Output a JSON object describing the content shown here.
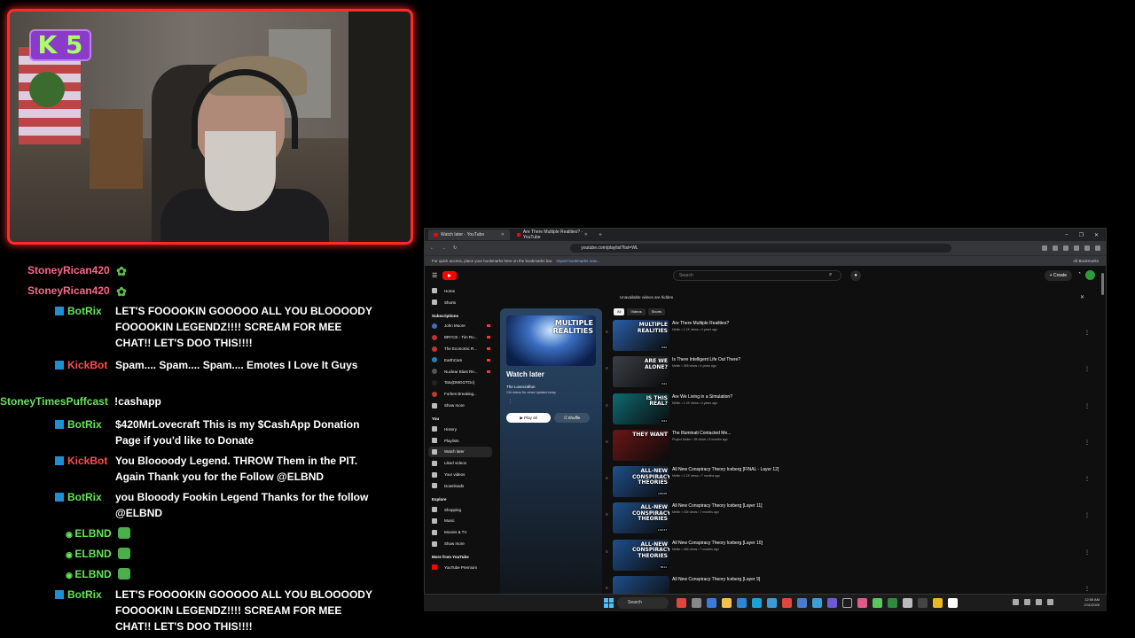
{
  "webcam": {
    "badge_text": "K 5"
  },
  "chat": {
    "messages": [
      {
        "user": "StoneyRican420",
        "text": "",
        "color": "pink"
      },
      {
        "user": "StoneyRican420",
        "text": "",
        "color": "pink"
      },
      {
        "user": "BotRix",
        "text": "LET'S FOOOOKIN GOOOOO ALL YOU BLOOOODY FOOOOKIN LEGENDZ!!!! SCREAM FOR MEE CHAT!! LET'S DOO THIS!!!!",
        "color": "green"
      },
      {
        "user": "KickBot",
        "text": "Spam.... Spam.... Spam.... Emotes I Love It Guys",
        "color": "red"
      },
      {
        "user": "StoneyTimesPuffcast",
        "text": "!cashapp",
        "color": "green"
      },
      {
        "user": "BotRix",
        "text": "$420MrLovecraft This is my $CashApp Donation Page if you'd like to Donate",
        "color": "green"
      },
      {
        "user": "KickBot",
        "text": "You Bloooody Legend. THROW Them in the PIT. Again Thank you for the Follow @ELBND",
        "color": "red"
      },
      {
        "user": "BotRix",
        "text": "you Blooody Fookin Legend Thanks for the follow @ELBND",
        "color": "green"
      },
      {
        "user": "ELBND",
        "text": "",
        "color": "green"
      },
      {
        "user": "ELBND",
        "text": "",
        "color": "green"
      },
      {
        "user": "ELBND",
        "text": "",
        "color": "green"
      },
      {
        "user": "BotRix",
        "text": "LET'S FOOOOKIN GOOOOO ALL YOU BLOOOODY FOOOOKIN LEGENDZ!!!! SCREAM FOR MEE CHAT!! LET'S DOO THIS!!!!",
        "color": "green"
      }
    ]
  },
  "browser": {
    "tabs": [
      {
        "title": "Watch later - YouTube",
        "active": true
      },
      {
        "title": "Are There Multiple Realities? - YouTube",
        "active": false
      }
    ],
    "new_tab": "+",
    "url": "youtube.com/playlist?list=WL",
    "bookmarks_notice": "For quick access, place your bookmarks here on the bookmarks bar.",
    "bookmarks_link": "Import bookmarks now...",
    "all_bookmarks": "All Bookmarks"
  },
  "youtube": {
    "search_placeholder": "Search",
    "create_label": "+ Create",
    "sidebar": {
      "top": [
        "Home",
        "Shorts"
      ],
      "subscriptions_title": "Subscriptions",
      "subscriptions": [
        "John Moore",
        "BRYCE - Tim Ro...",
        "The Economic R...",
        "EarthCam",
        "Nuclear Blast Re...",
        "Tatu(DMGGTOo)",
        "Forbes Breaking..."
      ],
      "show_more": "Show more",
      "you_title": "You",
      "you": [
        "History",
        "Playlists",
        "Watch later",
        "Liked videos",
        "Your videos",
        "Downloads"
      ],
      "explore_title": "Explore",
      "explore": [
        "Shopping",
        "Music",
        "Movies & TV",
        "Show more"
      ],
      "more_title": "More from YouTube",
      "more": [
        "YouTube Premium"
      ]
    },
    "playlist": {
      "thumb_text": "MULTIPLE REALITIES",
      "title": "Watch later",
      "owner": "The Lovecrafton",
      "meta": "134 videos  No views  Updated today",
      "play_all": "▶ Play all",
      "shuffle": "⤮ Shuffle"
    },
    "notice": "Unavailable videos are hidden",
    "chips": [
      "All",
      "Videos",
      "Shorts"
    ],
    "videos": [
      {
        "title": "Are There Multiple Realities?",
        "meta": "Meller • 1.1K views • 4 years ago",
        "thumb_text": "MULTIPLE REALITIES",
        "duration": "8:52",
        "color": "#2a5ea8"
      },
      {
        "title": "Is There Intelligent Life Out There?",
        "meta": "Meller • 395 views • 4 years ago",
        "thumb_text": "ARE WE ALONE?",
        "duration": "9:21",
        "color": "#3b3f46"
      },
      {
        "title": "Are We Living in a Simulation?",
        "meta": "Meller • 1.2K views • 4 years ago",
        "thumb_text": "IS THIS REAL?",
        "duration": "8:41",
        "color": "#0e6a73"
      },
      {
        "title": "The Illuminati Contacted Me...",
        "meta": "Project Meller • 95 views • 8 months ago",
        "thumb_text": "THEY WANT",
        "duration": "",
        "color": "#6b1515"
      },
      {
        "title": "All New Conspiracy Theory Iceberg [FINAL - Layer 12]",
        "meta": "Meller • 1.1K views • 7 months ago",
        "thumb_text": "ALL-NEW CONSPIRACY THEORIES",
        "duration": "2:05:05",
        "color": "#1f4f8a"
      },
      {
        "title": "All New Conspiracy Theory Iceberg [Layer 11]",
        "meta": "Meller • 334 views • 7 months ago",
        "thumb_text": "ALL-NEW CONSPIRACY THEORIES",
        "duration": "1:04:17",
        "color": "#1f4f8a"
      },
      {
        "title": "All New Conspiracy Theory Iceberg [Layer 10]",
        "meta": "Meller • 466 views • 7 months ago",
        "thumb_text": "ALL-NEW CONSPIRACY THEORIES",
        "duration": "59:11",
        "color": "#1f4f8a"
      },
      {
        "title": "All New Conspiracy Theory Iceberg [Layer 9]",
        "meta": "",
        "thumb_text": "",
        "duration": "",
        "color": "#1f4f8a"
      }
    ]
  },
  "taskbar": {
    "search_label": "Search",
    "time": "12:55 AM",
    "date": "2/11/2026"
  }
}
